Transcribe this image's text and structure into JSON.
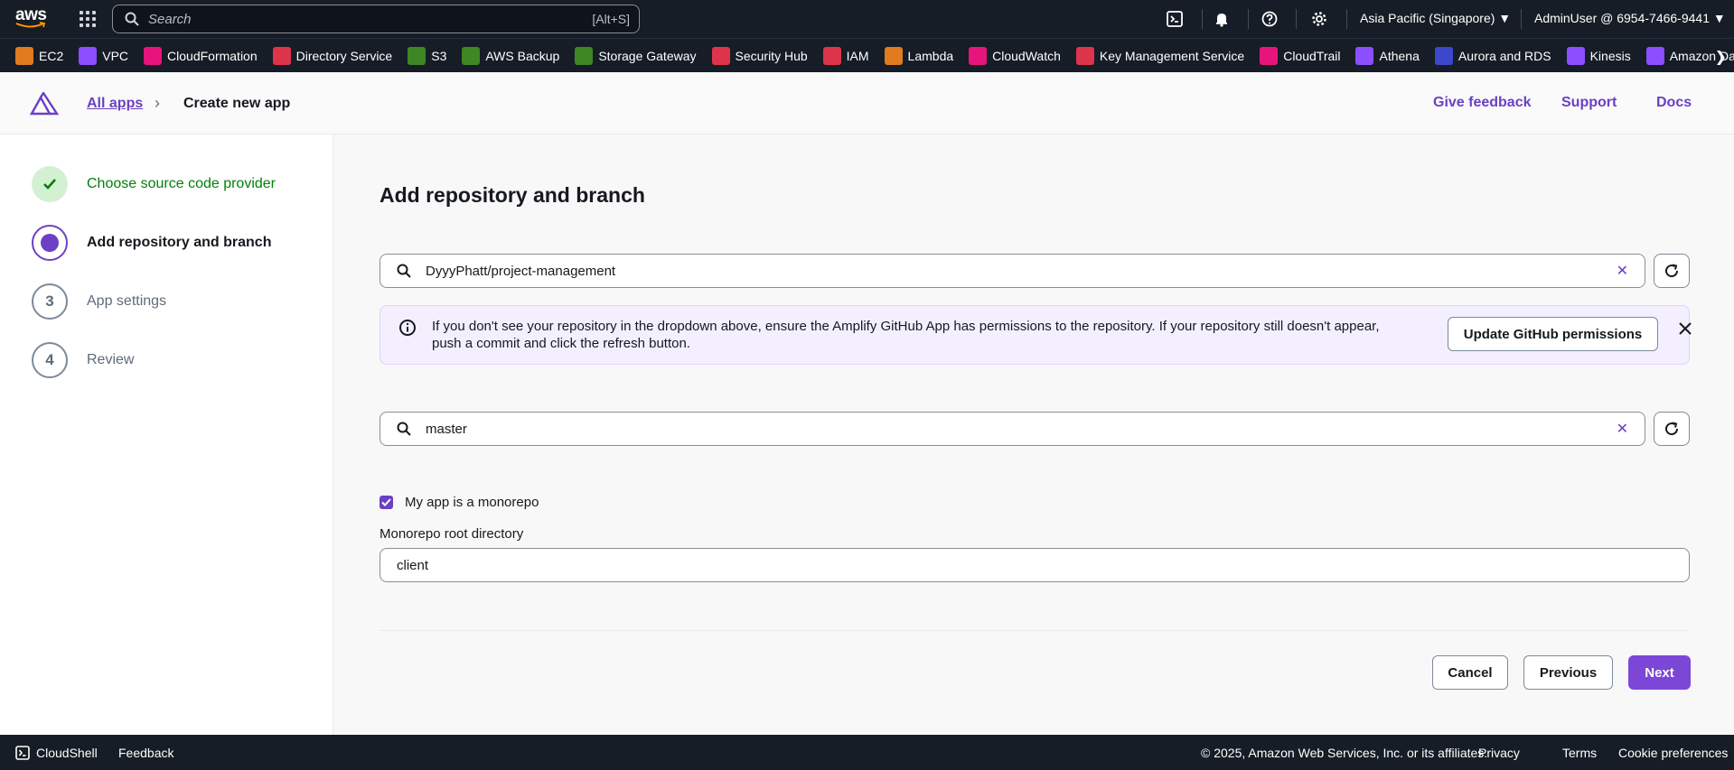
{
  "topnav": {
    "search_placeholder": "Search",
    "search_shortcut": "[Alt+S]",
    "region": "Asia Pacific (Singapore) ▼",
    "account": "AdminUser @ 6954-7466-9441 ▼",
    "logo_text": "aws"
  },
  "favorites": [
    {
      "label": "EC2",
      "color": "#e07b1f"
    },
    {
      "label": "VPC",
      "color": "#8c4fff"
    },
    {
      "label": "CloudFormation",
      "color": "#e7157b"
    },
    {
      "label": "Directory Service",
      "color": "#dd344c"
    },
    {
      "label": "S3",
      "color": "#3f8624"
    },
    {
      "label": "AWS Backup",
      "color": "#3f8624"
    },
    {
      "label": "Storage Gateway",
      "color": "#3f8624"
    },
    {
      "label": "Security Hub",
      "color": "#dd344c"
    },
    {
      "label": "IAM",
      "color": "#dd344c"
    },
    {
      "label": "Lambda",
      "color": "#e07b1f"
    },
    {
      "label": "CloudWatch",
      "color": "#e7157b"
    },
    {
      "label": "Key Management Service",
      "color": "#dd344c"
    },
    {
      "label": "CloudTrail",
      "color": "#e7157b"
    },
    {
      "label": "Athena",
      "color": "#8c4fff"
    },
    {
      "label": "Aurora and RDS",
      "color": "#3b48cc"
    },
    {
      "label": "Kinesis",
      "color": "#8c4fff"
    },
    {
      "label": "Amazon Data Firehose",
      "color": "#8c4fff"
    }
  ],
  "header": {
    "breadcrumb_link": "All apps",
    "breadcrumb_current": "Create new app",
    "give_feedback": "Give feedback",
    "support": "Support",
    "docs": "Docs"
  },
  "steps": [
    {
      "num": "",
      "label": "Choose source code provider",
      "state": "done"
    },
    {
      "num": "",
      "label": "Add repository and branch",
      "state": "active"
    },
    {
      "num": "3",
      "label": "App settings",
      "state": "todo"
    },
    {
      "num": "4",
      "label": "Review",
      "state": "todo"
    }
  ],
  "main": {
    "title": "Add repository and branch",
    "repo_value": "DyyyPhatt/project-management",
    "info_text": "If you don't see your repository in the dropdown above, ensure the Amplify GitHub App has permissions to the repository. If your repository still doesn't appear, push a commit and click the refresh button.",
    "info_button": "Update GitHub permissions",
    "branch_value": "master",
    "monorepo_label": "My app is a monorepo",
    "monorepo_checked": true,
    "root_dir_label": "Monorepo root directory",
    "root_dir_value": "client",
    "cancel": "Cancel",
    "previous": "Previous",
    "next": "Next"
  },
  "footer": {
    "cloudshell": "CloudShell",
    "feedback": "Feedback",
    "copyright": "© 2025, Amazon Web Services, Inc. or its affiliates.",
    "privacy": "Privacy",
    "terms": "Terms",
    "cookies": "Cookie preferences"
  },
  "colors": {
    "accent": "#6b40c4",
    "primary_button": "#7c47d6",
    "nav_bg": "#161d26",
    "success": "#037f0c"
  }
}
